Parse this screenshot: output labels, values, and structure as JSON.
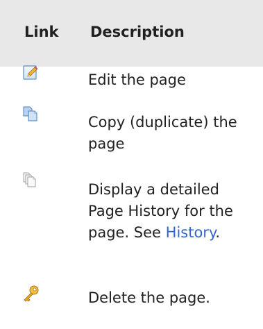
{
  "table": {
    "headers": {
      "link": "Link",
      "description": "Description"
    },
    "rows": [
      {
        "icon": "edit-pencil-icon",
        "description": "Edit the page"
      },
      {
        "icon": "copy-pages-icon",
        "description": "Copy (duplicate) the page"
      },
      {
        "icon": "history-pages-icon",
        "description_before": "Display a detailed Page History for the page. See ",
        "link_text": "History",
        "description_after": "."
      },
      {
        "icon": "delete-key-icon",
        "description": "Delete the page."
      }
    ]
  },
  "colors": {
    "header_background": "#e8e8e8",
    "text": "#202122",
    "link": "#3366cc"
  }
}
